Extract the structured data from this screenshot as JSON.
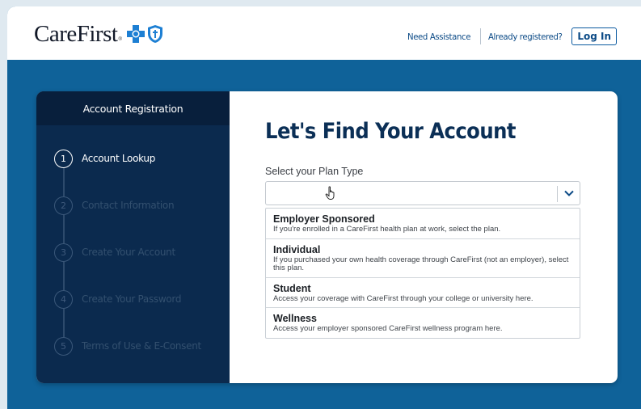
{
  "header": {
    "logo_text": "CareFirst",
    "logo_tm": "®",
    "need_assistance": "Need Assistance",
    "already_registered": "Already registered?",
    "login_label": "Log In"
  },
  "sidebar": {
    "title": "Account Registration",
    "steps": [
      {
        "num": "1",
        "label": "Account Lookup",
        "active": true
      },
      {
        "num": "2",
        "label": "Contact Information",
        "active": false
      },
      {
        "num": "3",
        "label": "Create Your Account",
        "active": false
      },
      {
        "num": "4",
        "label": "Create Your Password",
        "active": false
      },
      {
        "num": "5",
        "label": "Terms of Use & E-Consent",
        "active": false
      }
    ]
  },
  "main": {
    "title": "Let's Find Your Account",
    "plan_label": "Select your Plan Type",
    "plan_value": "",
    "options": [
      {
        "title": "Employer Sponsored",
        "desc": "If you're enrolled in a CareFirst health plan at work, select the plan."
      },
      {
        "title": "Individual",
        "desc": "If you purchased your own health coverage through CareFirst (not an employer), select this plan."
      },
      {
        "title": "Student",
        "desc": "Access your coverage with CareFirst through your college or university here."
      },
      {
        "title": "Wellness",
        "desc": "Access your employer sponsored CareFirst wellness program here."
      }
    ]
  },
  "icons": {
    "cross": "blue-cross-icon",
    "shield": "blue-shield-icon",
    "chevron": "chevron-down-icon",
    "cursor": "hand-pointer-icon"
  },
  "colors": {
    "page_bg": "#0f6299",
    "sidebar_bg": "#0b2a4e",
    "accent": "#0b4a86"
  }
}
